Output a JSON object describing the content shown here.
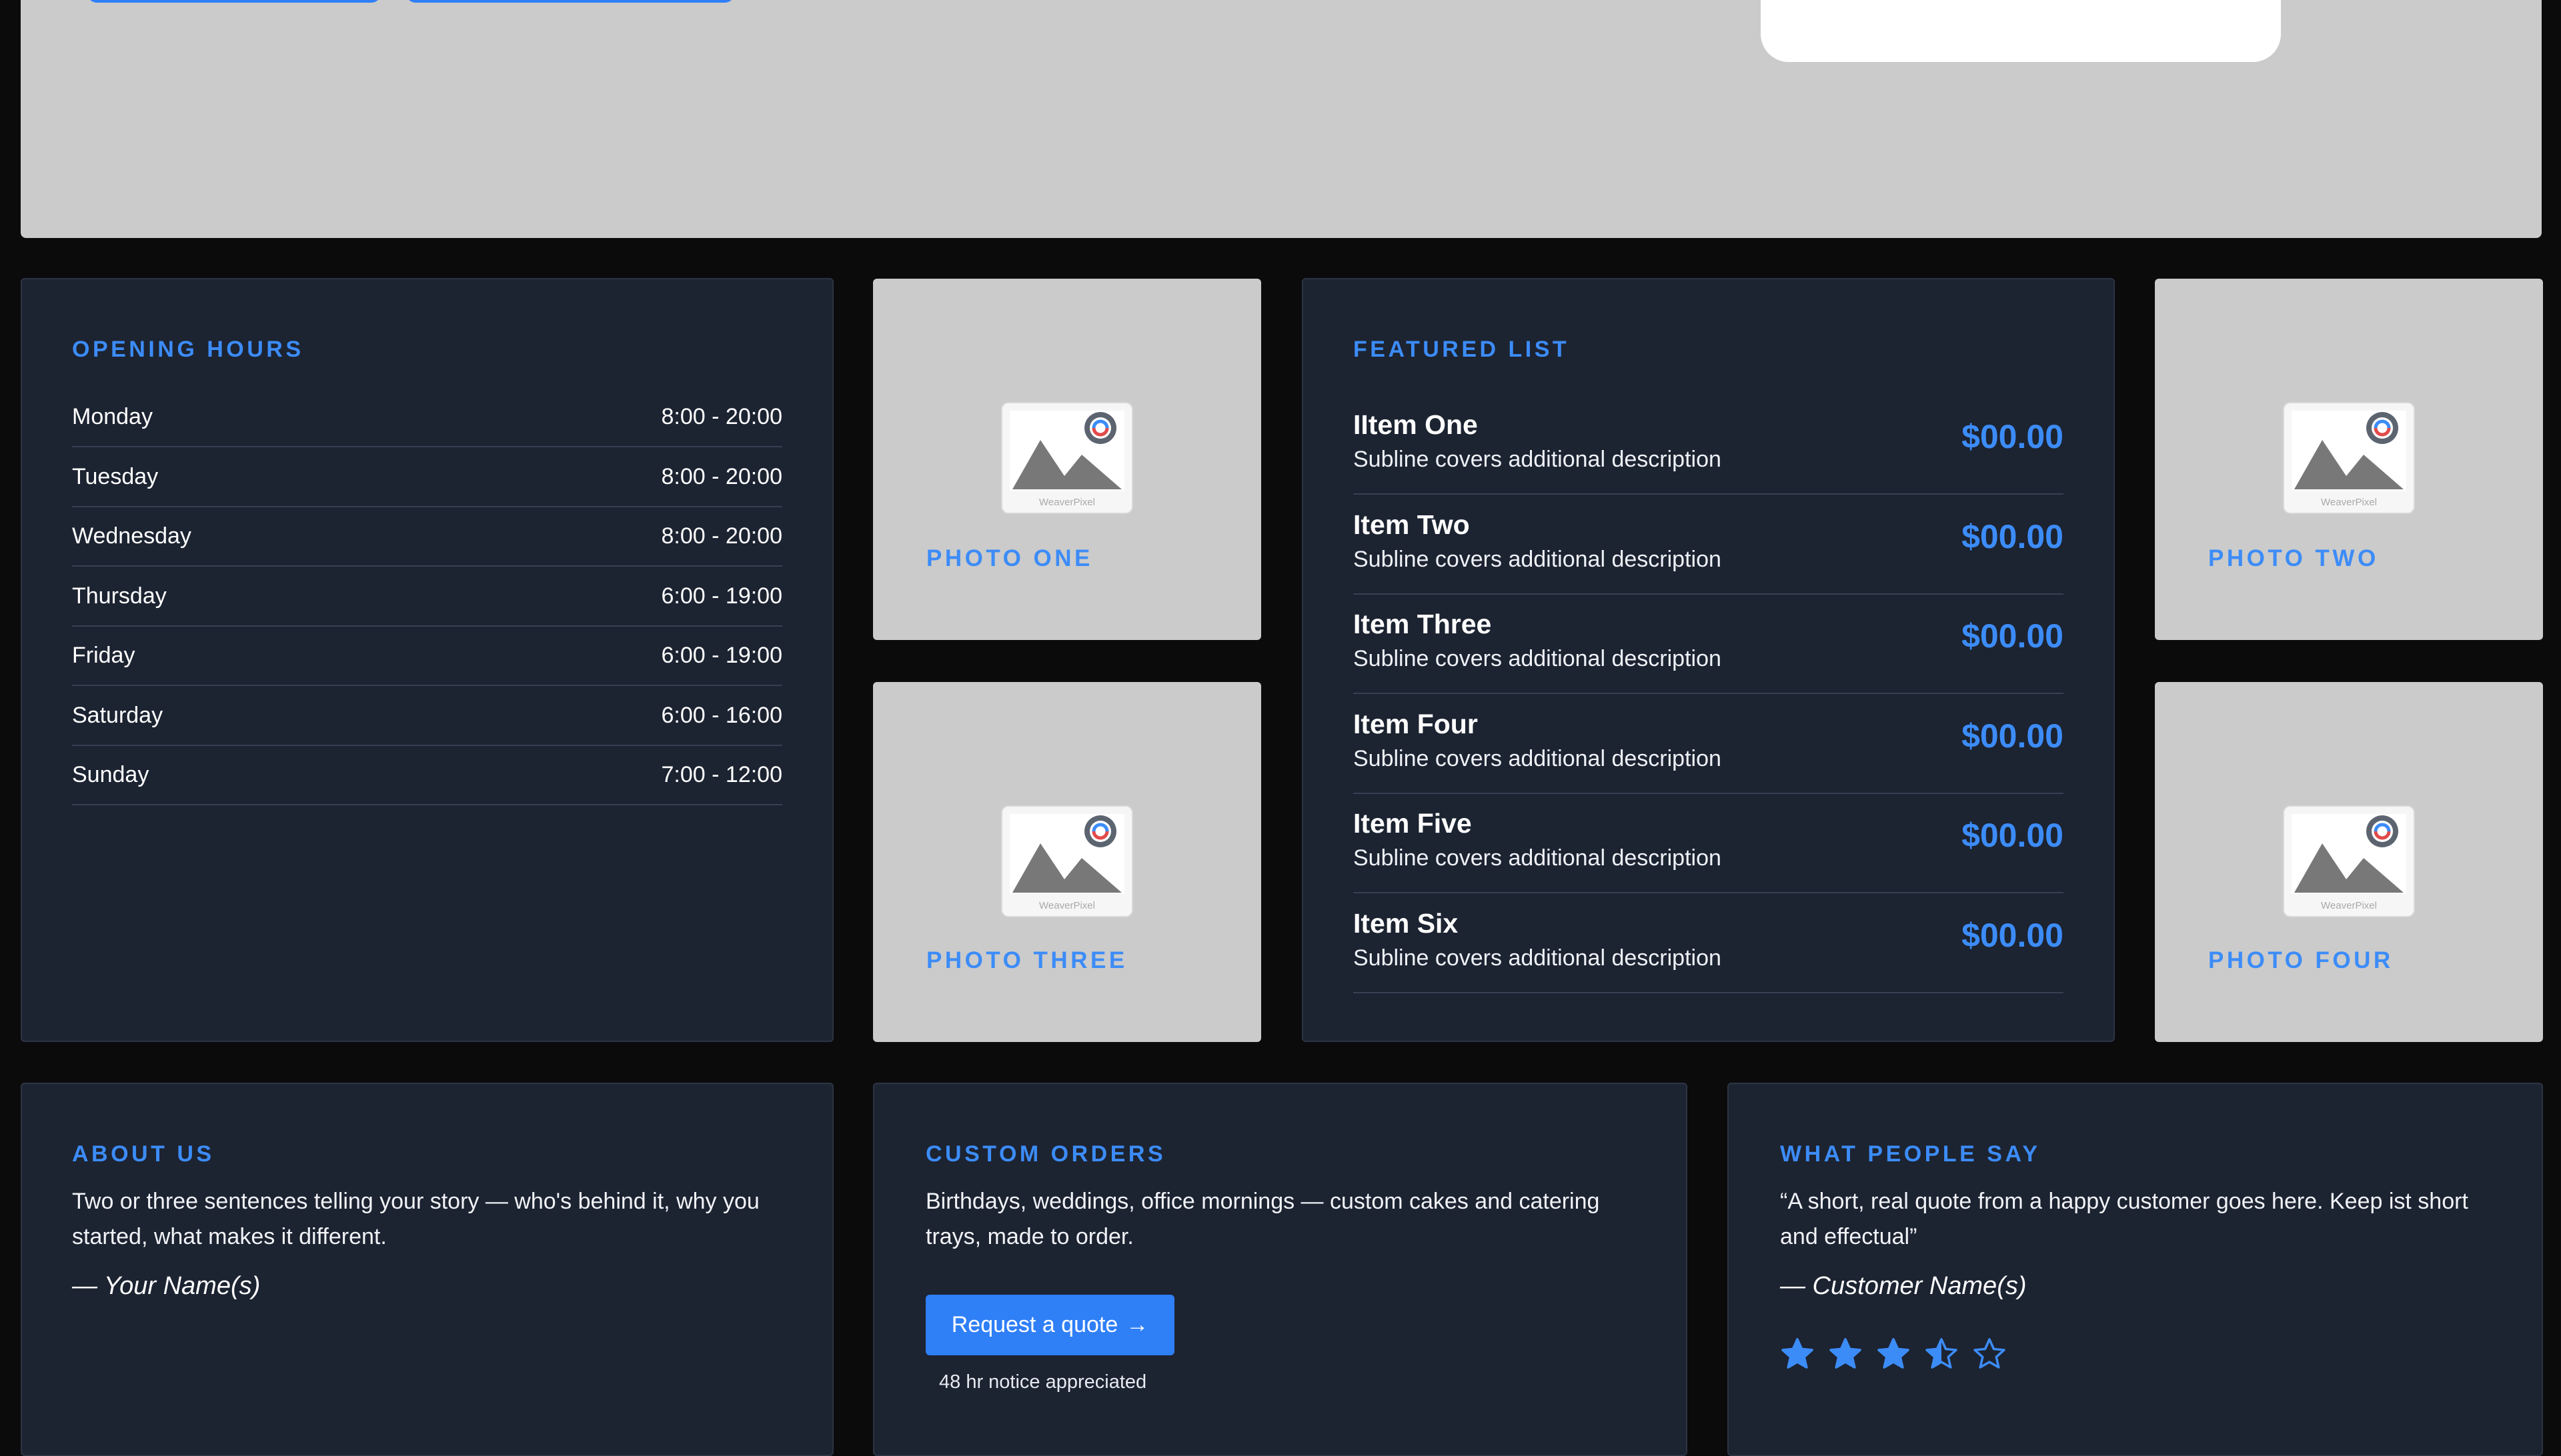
{
  "colors": {
    "accent": "#3c8cf8",
    "card_bg": "#1c2331",
    "page_bg": "#0b0b0c",
    "photo_bg": "#cbcbcb"
  },
  "hours": {
    "heading": "OPENING HOURS",
    "rows": [
      {
        "day": "Monday",
        "time": "8:00 - 20:00"
      },
      {
        "day": "Tuesday",
        "time": "8:00 - 20:00"
      },
      {
        "day": "Wednesday",
        "time": "8:00 - 20:00"
      },
      {
        "day": "Thursday",
        "time": "6:00 - 19:00"
      },
      {
        "day": "Friday",
        "time": "6:00 - 19:00"
      },
      {
        "day": "Saturday",
        "time": "6:00 - 16:00"
      },
      {
        "day": "Sunday",
        "time": "7:00 - 12:00"
      }
    ]
  },
  "photos": [
    {
      "label": "PHOTO ONE",
      "icon": "image-placeholder-icon",
      "watermark": "WeaverPixel"
    },
    {
      "label": "PHOTO TWO",
      "icon": "image-placeholder-icon",
      "watermark": "WeaverPixel"
    },
    {
      "label": "PHOTO THREE",
      "icon": "image-placeholder-icon",
      "watermark": "WeaverPixel"
    },
    {
      "label": "PHOTO FOUR",
      "icon": "image-placeholder-icon",
      "watermark": "WeaverPixel"
    }
  ],
  "featured": {
    "heading": "FEATURED LIST",
    "items": [
      {
        "title": "IItem One",
        "subtitle": "Subline covers additional description",
        "price": "$00.00"
      },
      {
        "title": "Item Two",
        "subtitle": "Subline covers additional description",
        "price": "$00.00"
      },
      {
        "title": "Item Three",
        "subtitle": "Subline covers additional description",
        "price": "$00.00"
      },
      {
        "title": "Item Four",
        "subtitle": "Subline covers additional description",
        "price": "$00.00"
      },
      {
        "title": "Item Five",
        "subtitle": "Subline covers additional description",
        "price": "$00.00"
      },
      {
        "title": "Item Six",
        "subtitle": "Subline covers additional description",
        "price": "$00.00"
      }
    ]
  },
  "about": {
    "heading": "ABOUT US",
    "text": "Two or three sentences telling your story — who's behind it, why you started, what makes it different.",
    "signature": "— Your Name(s)"
  },
  "custom_orders": {
    "heading": "CUSTOM ORDERS",
    "text": "Birthdays, weddings, office mornings — custom cakes and catering trays, made to order.",
    "button_label": "Request a quote",
    "button_icon": "arrow-right-icon",
    "button_arrow": "→",
    "note": "48 hr notice appreciated"
  },
  "testimonial": {
    "heading": "WHAT PEOPLE SAY",
    "quote": "“A short, real quote from a happy customer goes here. Keep ist short and effectual”",
    "author": "— Customer Name(s)",
    "rating": 3.5,
    "rating_max": 5
  }
}
